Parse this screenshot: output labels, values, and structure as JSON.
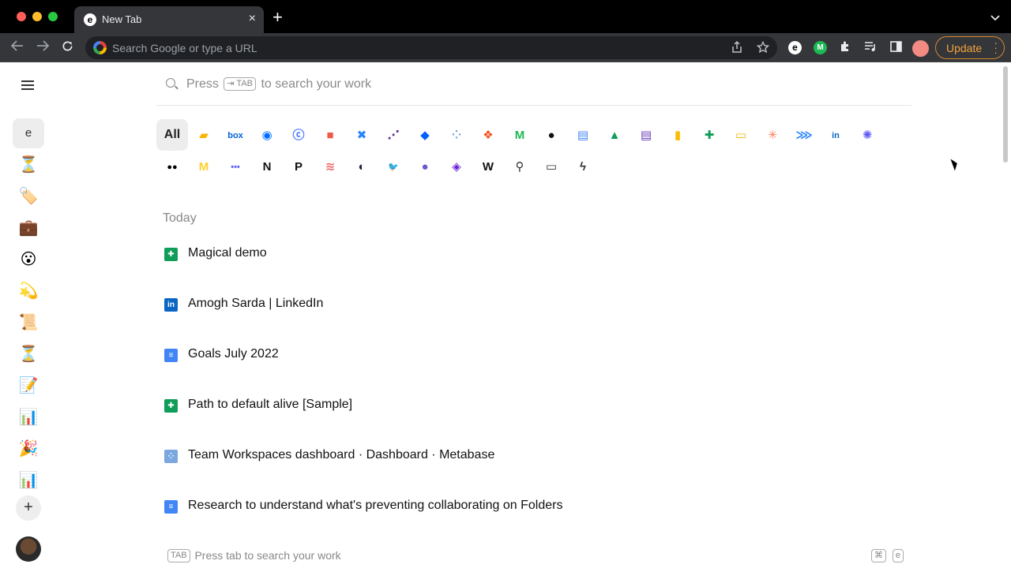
{
  "browser": {
    "tab": {
      "title": "New Tab",
      "favicon": "e-icon"
    },
    "omnibox": {
      "placeholder": "Search Google or type a URL"
    },
    "update_label": "Update"
  },
  "sidebar": {
    "active_label": "e",
    "items": [
      "⏳",
      "🏷️",
      "💼",
      "😮",
      "💫",
      "📜",
      "⏳",
      "📝",
      "📊",
      "🎉",
      "📊"
    ],
    "add_label": "+"
  },
  "search": {
    "prefix": "Press",
    "key": "⇥ TAB",
    "suffix": "to search your work"
  },
  "apps": {
    "all_label": "All",
    "row1": [
      {
        "icon": "airtable-icon",
        "color": "#fcb400",
        "glyph": "▰"
      },
      {
        "icon": "box-icon",
        "color": "#0061d5",
        "glyph": "box"
      },
      {
        "icon": "calendly-icon",
        "color": "#006bff",
        "glyph": "◉"
      },
      {
        "icon": "canva-icon",
        "color": "#3c6fff",
        "glyph": "ⓒ"
      },
      {
        "icon": "coda-icon",
        "color": "#ee5a4a",
        "glyph": "■"
      },
      {
        "icon": "confluence-icon",
        "color": "#2684ff",
        "glyph": "✖"
      },
      {
        "icon": "dialpad-icon",
        "color": "#5b2d8e",
        "glyph": "⋰"
      },
      {
        "icon": "dropbox-icon",
        "color": "#0061ff",
        "glyph": "◆"
      },
      {
        "icon": "metabase-icon",
        "color": "#7aa7e0",
        "glyph": "⁘"
      },
      {
        "icon": "figma-icon",
        "color": "#f24e1e",
        "glyph": "❖"
      },
      {
        "icon": "magical-icon",
        "color": "#1db954",
        "glyph": "M"
      },
      {
        "icon": "github-icon",
        "color": "#111111",
        "glyph": "●"
      },
      {
        "icon": "google-docs-icon",
        "color": "#4285f4",
        "glyph": "▤"
      },
      {
        "icon": "google-drive-icon",
        "color": "#0f9d58",
        "glyph": "▲"
      },
      {
        "icon": "google-forms-icon",
        "color": "#673ab7",
        "glyph": "▤"
      },
      {
        "icon": "google-keep-icon",
        "color": "#fbbc04",
        "glyph": "▮"
      },
      {
        "icon": "google-sheets-icon",
        "color": "#0f9d58",
        "glyph": "✚"
      },
      {
        "icon": "google-slides-icon",
        "color": "#f4b400",
        "glyph": "▭"
      },
      {
        "icon": "hubspot-icon",
        "color": "#ff7a59",
        "glyph": "✳"
      },
      {
        "icon": "jira-icon",
        "color": "#2684ff",
        "glyph": "⋙"
      },
      {
        "icon": "linkedin-icon",
        "color": "#0a66c2",
        "glyph": "in"
      },
      {
        "icon": "loom-icon",
        "color": "#625df5",
        "glyph": "✺"
      }
    ],
    "row2": [
      {
        "icon": "medium-icon",
        "color": "#000000",
        "glyph": "●●"
      },
      {
        "icon": "miro-icon",
        "color": "#ffd02f",
        "glyph": "M"
      },
      {
        "icon": "monday-icon",
        "color": "#6161ff",
        "glyph": "•••"
      },
      {
        "icon": "notion-icon",
        "color": "#111111",
        "glyph": "N"
      },
      {
        "icon": "pitch-icon",
        "color": "#111111",
        "glyph": "P"
      },
      {
        "icon": "asana-icon",
        "color": "#f06a6a",
        "glyph": "≋"
      },
      {
        "icon": "linear-icon",
        "color": "#1e1f3b",
        "glyph": "◐"
      },
      {
        "icon": "twitter-icon",
        "color": "#1da1f2",
        "glyph": "🐦"
      },
      {
        "icon": "remote-icon",
        "color": "#6a5acd",
        "glyph": "●"
      },
      {
        "icon": "superhuman-icon",
        "color": "#6b1fd6",
        "glyph": "◈"
      },
      {
        "icon": "wikipedia-icon",
        "color": "#111111",
        "glyph": "W"
      },
      {
        "icon": "contacts-icon",
        "color": "#333333",
        "glyph": "⚲"
      },
      {
        "icon": "folder-icon",
        "color": "#333333",
        "glyph": "▭"
      },
      {
        "icon": "lightning-icon",
        "color": "#333333",
        "glyph": "ϟ"
      }
    ]
  },
  "recent": {
    "heading": "Today",
    "items": [
      {
        "label": "Magical demo",
        "icon": "google-sheets-icon",
        "color": "#0f9d58",
        "glyph": "✚"
      },
      {
        "label": "Amogh Sarda | LinkedIn",
        "icon": "linkedin-icon",
        "color": "#0a66c2",
        "glyph": "in"
      },
      {
        "label": "Goals July 2022",
        "icon": "google-docs-icon",
        "color": "#4285f4",
        "glyph": "≡"
      },
      {
        "label": "Path to default alive [Sample]",
        "icon": "google-sheets-icon",
        "color": "#0f9d58",
        "glyph": "✚"
      },
      {
        "label": "Team Workspaces dashboard · Dashboard · Metabase",
        "icon": "metabase-icon",
        "color": "#7aa7e0",
        "glyph": "⁘"
      },
      {
        "label": "Research to understand what's preventing collaborating on Folders",
        "icon": "google-docs-icon",
        "color": "#4285f4",
        "glyph": "≡"
      }
    ]
  },
  "footer": {
    "key": "TAB",
    "hint": "Press tab to search your work",
    "shortcut": [
      "⌘",
      "e"
    ]
  }
}
